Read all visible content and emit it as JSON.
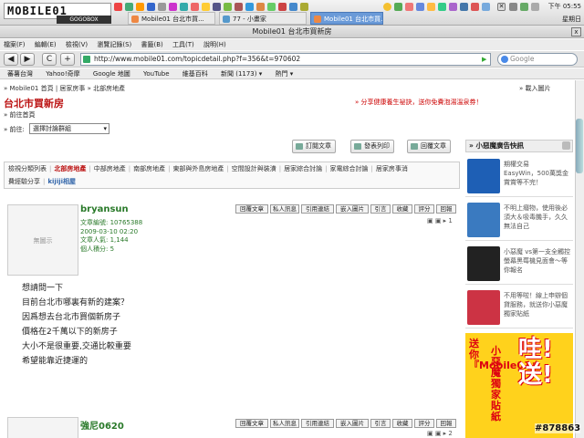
{
  "taskbar": {
    "logo": "MOBILE01",
    "logo_sub": "GOGOBOX",
    "tasks": [
      "Mobile01 台北市買...",
      "77 - 小畫家",
      "Mobile01 台北市買..."
    ],
    "clock": "下午 05:55",
    "weekday": "星期日",
    "close_glyph": "✕"
  },
  "window": {
    "title": "Mobile01 台北市買新房",
    "close_glyph": "x"
  },
  "menubar": [
    "檔案(F)",
    "編輯(E)",
    "檢視(V)",
    "瀏覽記錄(S)",
    "書籤(B)",
    "工具(T)",
    "說明(H)"
  ],
  "nav": {
    "back": "◀",
    "forward": "▶",
    "reload": "C",
    "new": "+",
    "url": "http://www.mobile01.com/topicdetail.php?f=356&t=970602",
    "search_placeholder": "Google",
    "go_glyph": "▶"
  },
  "bookmarks": [
    "蕃薯台灣",
    "Yahoo!奇摩",
    "Google 地圖",
    "YouTube",
    "維基百科",
    "新聞 (1173) ▾",
    "熱門 ▾"
  ],
  "page": {
    "breadcrumb": "» Mobile01 首頁 | 居家房事 » 北部房地產",
    "breadcrumb_right": "» 載入圖片",
    "forum_title": "台北市買新房",
    "promo": "» 分享健康養生祕訣，送你免費泡湯溫泉券！",
    "goto_home": "» 前往首頁",
    "goto_label": "» 前往:",
    "group_select": "選擇討論群組",
    "tools": [
      "訂閱文章",
      "發表列印",
      "回覆文章"
    ],
    "categories_row1": [
      "檢視分類列表",
      "北部房地產",
      "中部房地產",
      "南部房地產",
      "東部與外島房地產",
      "空間設計與裝潢",
      "居家綜合討論",
      "家電綜合討論",
      "居家房事消"
    ],
    "categories_row2_a": "費經驗分享",
    "categories_row2_b": "kijiji相屋"
  },
  "posts": [
    {
      "avatar_text": "無圖示",
      "username": "bryansun",
      "meta": [
        "文章編號: 10765388",
        "2009-03-10 02:20",
        "文章人氣: 1,144",
        "個人積分: 5"
      ],
      "buttons": [
        "回覆文章",
        "私人訊息",
        "引用連結",
        "嵌入圖片",
        "引言",
        "收藏",
        "評分",
        "回報"
      ],
      "page_marker": "1",
      "lines": [
        "想請問一下",
        "目前台北市哪裏有新的建案？",
        "因爲想去台北市買個新房子",
        "價格在2千萬以下的新房子",
        "大小不是很重要,交通比較重要",
        "希望能靠近捷運的"
      ]
    },
    {
      "username": "強尼0620",
      "buttons": [
        "回覆文章",
        "私人訊息",
        "引用連結",
        "嵌入圖片",
        "引言",
        "收藏",
        "評分",
        "回報"
      ],
      "page_marker": "2"
    }
  ],
  "sidebar": {
    "header": "» 小惡魔廣告快訊",
    "ads": [
      {
        "text": "期權交易\nEasyWin，500萬獎金賞賞等不完！",
        "color": "#1e5fb5"
      },
      {
        "text": "不明上癮物，使用後必須大＆吸毒饑手，久久無法自己",
        "color": "#3a7ac0"
      },
      {
        "text": "小惡魔 vs第一支全觸控螢幕黑莓機見面會～等你報名",
        "color": "#222222"
      },
      {
        "text": "不用等啦！線上申辦個貸服務，就送你小惡魔獨家貼紙",
        "color": "#cc3344"
      }
    ],
    "big_ad_left": "送你『Mobile01』",
    "big_ad_mid": "小惡魔獨家貼紙",
    "big_ad_right": "哇!送!"
  },
  "watermark": "#878863"
}
